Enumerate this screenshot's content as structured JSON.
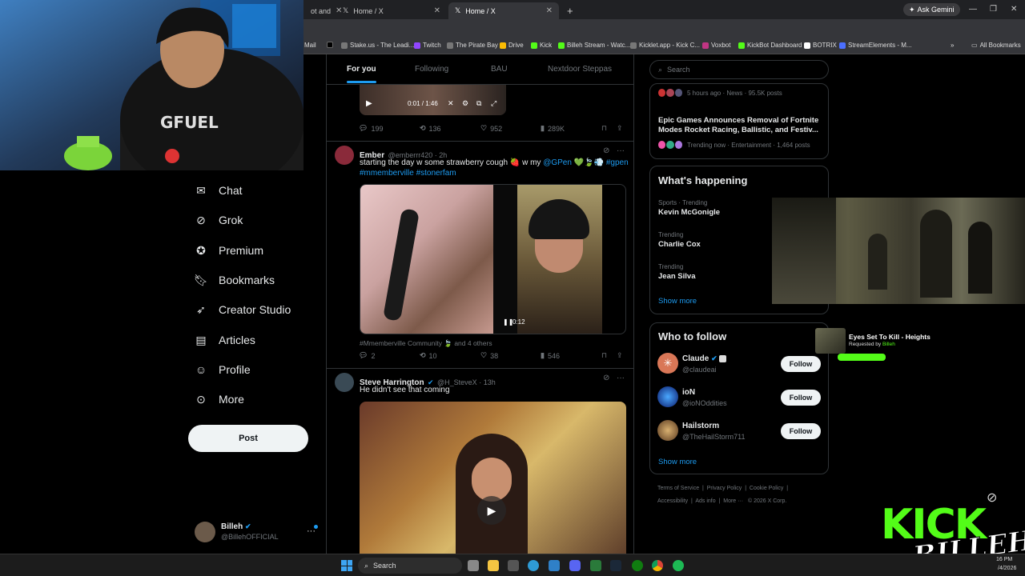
{
  "browser": {
    "tabs": [
      {
        "title": "ot and"
      },
      {
        "title": "Home / X"
      },
      {
        "title": "Home / X"
      }
    ],
    "new_tab": "+",
    "ask_gemini": "Ask Gemini",
    "bookmarks": [
      "Mail",
      "Stake.us - The Leadi...",
      "Twitch",
      "The Pirate Bay",
      "Drive",
      "Kick",
      "Billeh Stream - Watc...",
      "Kicklet.app - Kick C...",
      "Voxbot",
      "KickBot Dashboard",
      "BOTRIX",
      "StreamElements - M..."
    ],
    "all_bookmarks": "All Bookmarks"
  },
  "nav": {
    "items": [
      {
        "label": "Chat",
        "icon": "mail-icon"
      },
      {
        "label": "Grok",
        "icon": "grok-icon"
      },
      {
        "label": "Premium",
        "icon": "premium-icon"
      },
      {
        "label": "Bookmarks",
        "icon": "bookmark-icon"
      },
      {
        "label": "Creator Studio",
        "icon": "rocket-icon"
      },
      {
        "label": "Articles",
        "icon": "article-icon"
      },
      {
        "label": "Profile",
        "icon": "profile-icon"
      },
      {
        "label": "More",
        "icon": "more-circle-icon"
      }
    ],
    "post_label": "Post",
    "account": {
      "name": "Billeh",
      "handle": "@BillehOFFICIAL",
      "more": "···"
    }
  },
  "feed": {
    "tabs": [
      "For you",
      "Following",
      "BAU",
      "Nextdoor Steppas"
    ],
    "top_post": {
      "video_time": "0:01 / 1:46",
      "stats": {
        "replies": "199",
        "reposts": "136",
        "likes": "952",
        "views": "289K"
      }
    },
    "post1": {
      "name": "Ember",
      "handle": "@emberrr420 · 2h",
      "text": "starting the day w some strawberry cough 🍓 w my",
      "mention": "@GPen",
      "tags_inline": "#gpen",
      "tags_line2": "#mmemberville #stonerfam",
      "video_time": "0:12",
      "community": "#Mmemberville Community",
      "community_suffix": "and 4 others",
      "stats": {
        "replies": "2",
        "reposts": "10",
        "likes": "38",
        "views": "546"
      }
    },
    "post2": {
      "name": "Steve Harrington",
      "handle": "@H_SteveX · 13h",
      "text": "He didn't see that coming"
    }
  },
  "right": {
    "search_placeholder": "Search",
    "news1_meta": "5 hours ago · News · 95.5K posts",
    "news2_title": "Epic Games Announces Removal of Fortnite Modes Rocket Racing, Ballistic, and Festiv...",
    "news2_meta": "Trending now · Entertainment · 1,464 posts",
    "happening": {
      "title": "What's happening",
      "trends": [
        {
          "context": "Sports · Trending",
          "name": "Kevin McGonigle"
        },
        {
          "context": "Trending",
          "name": "Charlie Cox"
        },
        {
          "context": "Trending",
          "name": "Jean Silva"
        }
      ],
      "show_more": "Show more"
    },
    "follow": {
      "title": "Who to follow",
      "accounts": [
        {
          "name": "Claude",
          "handle": "@claudeai",
          "button": "Follow"
        },
        {
          "name": "ioN",
          "handle": "@ioNOddities",
          "button": "Follow"
        },
        {
          "name": "Hailstorm",
          "handle": "@TheHailStorm711",
          "button": "Follow"
        }
      ],
      "show_more": "Show more"
    },
    "footer": {
      "line1": [
        "Terms of Service",
        "Privacy Policy",
        "Cookie Policy"
      ],
      "line2": [
        "Accessibility",
        "Ads info",
        "More ···",
        "© 2026 X Corp."
      ]
    }
  },
  "overlay": {
    "song_title": "Eyes Set To Kill - Heights",
    "requested_by": "Requested by",
    "requester": "Billeh",
    "kick_text": "KICK",
    "billeh_signature": "BILLEH"
  },
  "taskbar": {
    "search": "Search",
    "time": "16 PM",
    "date": "/4/2026"
  },
  "colors": {
    "accent": "#1d9bf0",
    "kick_green": "#53fc18",
    "verified": "#1d9bf0"
  }
}
